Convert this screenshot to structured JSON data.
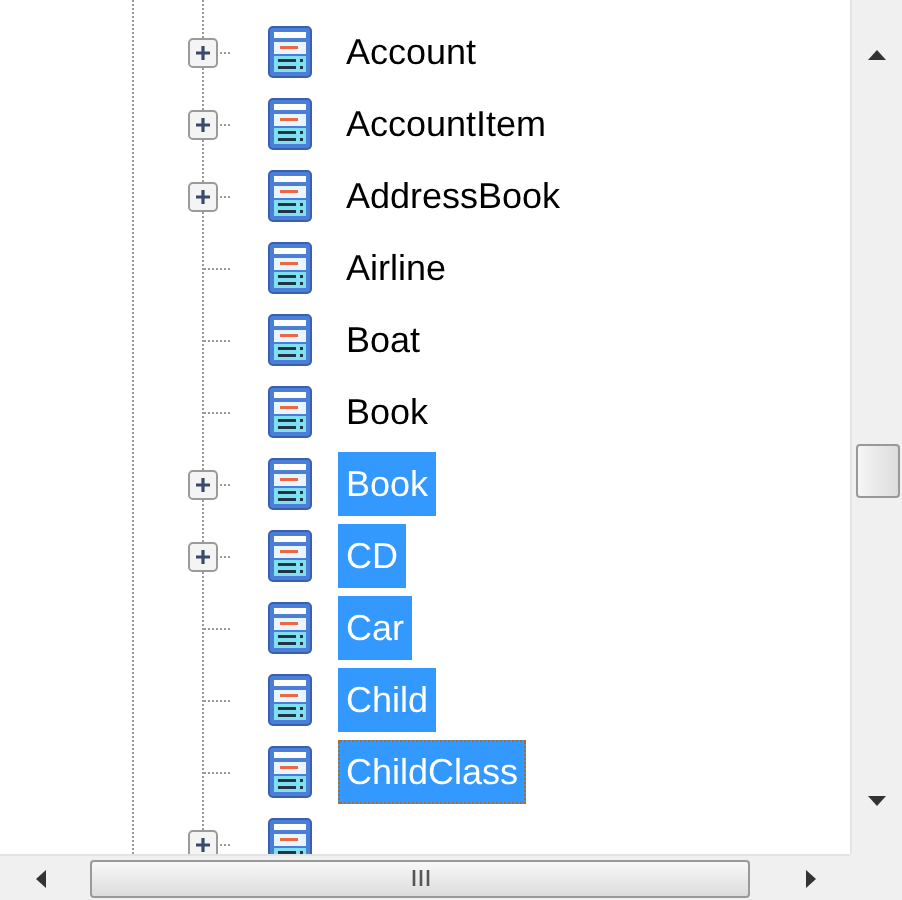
{
  "tree": {
    "items": [
      {
        "label": "Account",
        "expandable": true,
        "selected": false,
        "focused": false
      },
      {
        "label": "AccountItem",
        "expandable": true,
        "selected": false,
        "focused": false
      },
      {
        "label": "AddressBook",
        "expandable": true,
        "selected": false,
        "focused": false
      },
      {
        "label": "Airline",
        "expandable": false,
        "selected": false,
        "focused": false
      },
      {
        "label": "Boat",
        "expandable": false,
        "selected": false,
        "focused": false
      },
      {
        "label": "Book",
        "expandable": false,
        "selected": false,
        "focused": false
      },
      {
        "label": "Book",
        "expandable": true,
        "selected": true,
        "focused": false
      },
      {
        "label": "CD",
        "expandable": true,
        "selected": true,
        "focused": false
      },
      {
        "label": "Car",
        "expandable": false,
        "selected": true,
        "focused": false
      },
      {
        "label": "Child",
        "expandable": false,
        "selected": true,
        "focused": false
      },
      {
        "label": "ChildClass",
        "expandable": false,
        "selected": true,
        "focused": true
      },
      {
        "expandable": true
      }
    ]
  }
}
